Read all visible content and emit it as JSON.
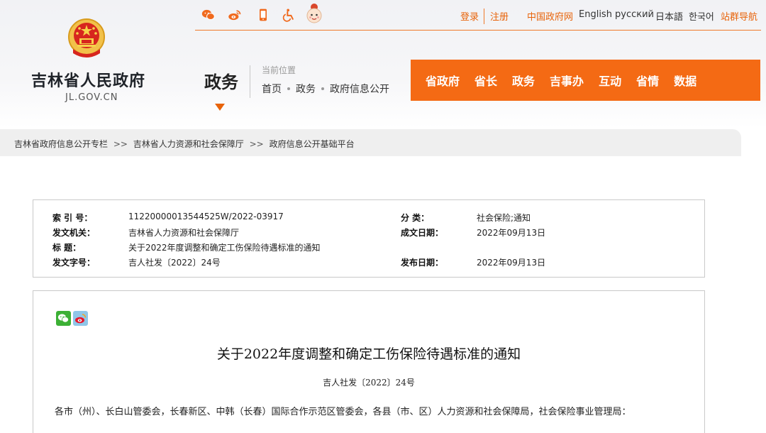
{
  "header": {
    "top_icons": [
      "wechat-icon",
      "weibo-icon",
      "mobile-icon",
      "accessibility-icon",
      "mascot-icon"
    ],
    "top_links": {
      "login": "登录",
      "register": "注册",
      "gov_portal": "中国政府网",
      "english": "English",
      "russian": "русский",
      "japanese": "日本語",
      "korean": "한국어",
      "sitemap": "站群导航"
    },
    "site_name": "吉林省人民政府",
    "site_domain": "JL.GOV.CN",
    "section_title": "政务",
    "location_label": "当前位置",
    "location_trail": [
      "首页",
      "政务",
      "政府信息公开"
    ],
    "nav": [
      "省政府",
      "省长",
      "政务",
      "吉事办",
      "互动",
      "省情",
      "数据"
    ],
    "accent_color": "#f46a14"
  },
  "breadcrumb": {
    "items": [
      "吉林省政府信息公开专栏",
      "吉林省人力资源和社会保障厅",
      "政府信息公开基础平台"
    ],
    "separator": ">>"
  },
  "meta": {
    "index_label": "索  引  号：",
    "index_value": "11220000013544525W/2022-03917",
    "category_label": "分      类：",
    "category_value": "社会保险;通知",
    "issuer_label": "发文机关：",
    "issuer_value": "吉林省人力资源和社会保障厅",
    "written_date_label": "成文日期：",
    "written_date_value": "2022年09月13日",
    "title_label": "标      题：",
    "title_value": "关于2022年度调整和确定工伤保险待遇标准的通知",
    "doc_no_label": "发文字号：",
    "doc_no_value": "吉人社发〔2022〕24号",
    "publish_date_label": "发布日期：",
    "publish_date_value": "2022年09月13日"
  },
  "document": {
    "share_icons": [
      "wechat-share-icon",
      "weibo-share-icon"
    ],
    "title": "关于2022年度调整和确定工伤保险待遇标准的通知",
    "number": "吉人社发〔2022〕24号",
    "salutation": "各市（州）、长白山管委会，长春新区、中韩（长春）国际合作示范区管委会，各县（市、区）人力资源和社会保障局，社会保险事业管理局："
  }
}
